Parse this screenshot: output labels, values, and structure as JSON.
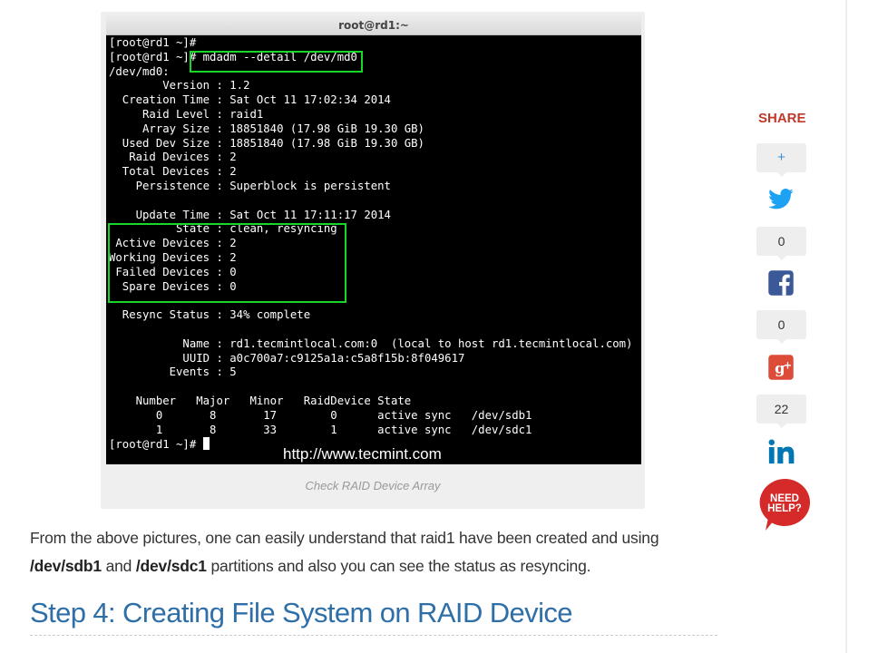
{
  "figure": {
    "window_title": "root@rd1:~",
    "terminal_lines": [
      "[root@rd1 ~]#",
      "[root@rd1 ~]# mdadm --detail /dev/md0",
      "/dev/md0:",
      "        Version : 1.2",
      "  Creation Time : Sat Oct 11 17:02:34 2014",
      "     Raid Level : raid1",
      "     Array Size : 18851840 (17.98 GiB 19.30 GB)",
      "  Used Dev Size : 18851840 (17.98 GiB 19.30 GB)",
      "   Raid Devices : 2",
      "  Total Devices : 2",
      "    Persistence : Superblock is persistent",
      "",
      "    Update Time : Sat Oct 11 17:11:17 2014",
      "          State : clean, resyncing",
      " Active Devices : 2",
      "Working Devices : 2",
      " Failed Devices : 0",
      "  Spare Devices : 0",
      "",
      "  Resync Status : 34% complete",
      "",
      "           Name : rd1.tecmintlocal.com:0  (local to host rd1.tecmintlocal.com)",
      "           UUID : a0c700a7:c9125a1a:c5a8f15b:8f049617",
      "         Events : 5",
      "",
      "    Number   Major   Minor   RaidDevice State",
      "       0       8       17        0      active sync   /dev/sdb1",
      "       1       8       33        1      active sync   /dev/sdc1",
      "[root@rd1 ~]# "
    ],
    "watermark": "http://www.tecmint.com",
    "caption": "Check RAID Device Array"
  },
  "article": {
    "para_1": "From the above pictures, one can easily understand that raid1 have been created and using",
    "para_code_1": "/dev/sdb1",
    "para_and": " and ",
    "para_code_2": "/dev/sdc1",
    "para_2": " partitions and also you can see the status as resyncing.",
    "heading": "Step 4: Creating File System on RAID Device"
  },
  "share": {
    "title": "SHARE",
    "plus_label": "+",
    "twitter_count": "0",
    "facebook_count": "0",
    "linkedin_count": "22",
    "need_help_line1": "NEED",
    "need_help_line2": "HELP?",
    "colors": {
      "twitter": "#1da1f2",
      "facebook": "#3b5998",
      "googleplus": "#dd4b39",
      "linkedin": "#0077b5",
      "need_help": "#d42a2a"
    }
  }
}
